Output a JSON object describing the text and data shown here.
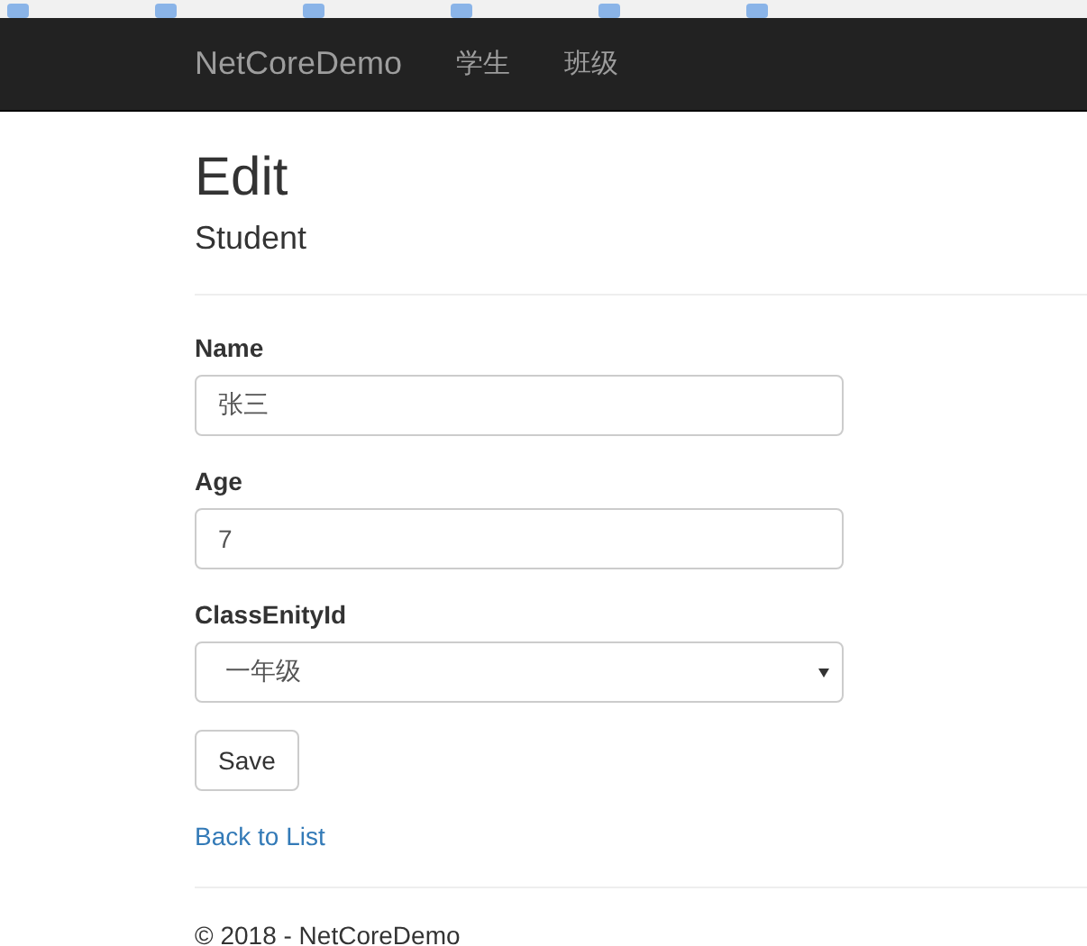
{
  "navbar": {
    "brand": "NetCoreDemo",
    "links": [
      {
        "label": "学生"
      },
      {
        "label": "班级"
      }
    ]
  },
  "page": {
    "title": "Edit",
    "subtitle": "Student"
  },
  "form": {
    "fields": [
      {
        "kind": "text",
        "label": "Name",
        "value": "张三"
      },
      {
        "kind": "text",
        "label": "Age",
        "value": "7"
      },
      {
        "kind": "select",
        "label": "ClassEnityId",
        "value": "一年级"
      }
    ],
    "submit": "Save"
  },
  "back_link": "Back to List",
  "footer": "© 2018 - NetCoreDemo"
}
